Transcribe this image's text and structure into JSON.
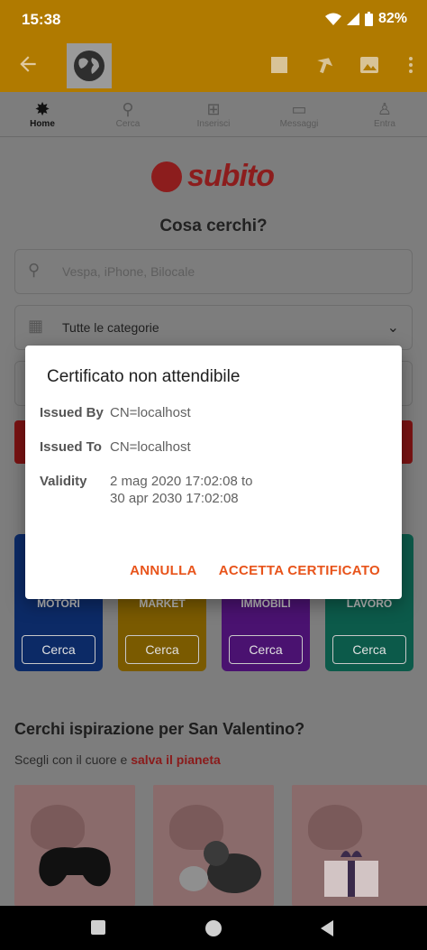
{
  "status_bar": {
    "time": "15:38",
    "battery": "82%",
    "icons": [
      "wifi-icon",
      "signal-icon",
      "battery-icon"
    ]
  },
  "app_bar": {
    "icons": [
      "back-arrow-icon",
      "globe-icon",
      "stop-icon",
      "share-icon",
      "image-icon",
      "more-vert-icon"
    ]
  },
  "nav_tabs": [
    {
      "label": "Home",
      "icon": "home-icon",
      "active": true
    },
    {
      "label": "Cerca",
      "icon": "search-icon",
      "active": false
    },
    {
      "label": "Inserisci",
      "icon": "add-icon",
      "active": false
    },
    {
      "label": "Messaggi",
      "icon": "chat-icon",
      "active": false
    },
    {
      "label": "Entra",
      "icon": "user-icon",
      "active": false
    }
  ],
  "logo": {
    "text": "subito"
  },
  "search": {
    "heading": "Cosa cerchi?",
    "placeholder": "Vespa, iPhone, Bilocale",
    "category_value": "Tutte le categorie"
  },
  "categories": [
    {
      "name": "MOTORI",
      "button": "Cerca"
    },
    {
      "name": "MARKET",
      "button": "Cerca"
    },
    {
      "name": "IMMOBILI",
      "button": "Cerca"
    },
    {
      "name": "LAVORO",
      "button": "Cerca"
    }
  ],
  "inspiration": {
    "title": "Cerchi ispirazione per San Valentino?",
    "subtitle_prefix": "Scegli con il cuore e",
    "subtitle_highlight": "salva il pianeta"
  },
  "dialog": {
    "title": "Certificato non attendibile",
    "rows": [
      {
        "label": "Issued By",
        "value": "CN=localhost"
      },
      {
        "label": "Issued To",
        "value": "CN=localhost"
      },
      {
        "label": "Validity",
        "value_line1": "2 mag 2020 17:02:08 to",
        "value_line2": "30 apr 2030 17:02:08"
      }
    ],
    "cancel_label": "ANNULLA",
    "accept_label": "ACCETTA CERTIFICATO"
  },
  "colors": {
    "accent": "#e8541b",
    "brand": "#c8102e",
    "app_bar": "#f5a800"
  }
}
